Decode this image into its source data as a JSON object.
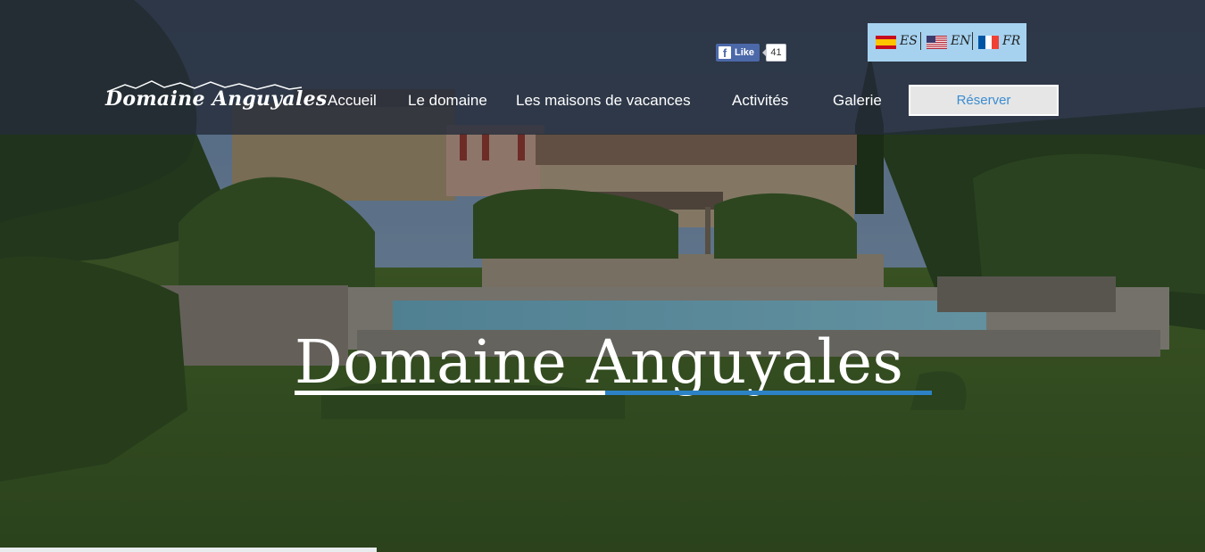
{
  "site": {
    "logo_text": "Domaine Anguyales",
    "hero_title": "Domaine Anguyales"
  },
  "nav": {
    "items": [
      "Accueil",
      "Le domaine",
      "Les maisons de vacances",
      "Activités",
      "Galerie"
    ],
    "reserve_label": "Réserver"
  },
  "facebook": {
    "like_label": "Like",
    "count": "41"
  },
  "languages": [
    {
      "code": "ES",
      "icon": "spain-flag-icon"
    },
    {
      "code": "EN",
      "icon": "usa-flag-icon"
    },
    {
      "code": "FR",
      "icon": "france-flag-icon"
    }
  ],
  "colors": {
    "accent_blue": "#2c82c5",
    "reserve_text": "#3b8dd1",
    "language_box": "#a6d2f0",
    "facebook_blue": "#4b68a8"
  }
}
